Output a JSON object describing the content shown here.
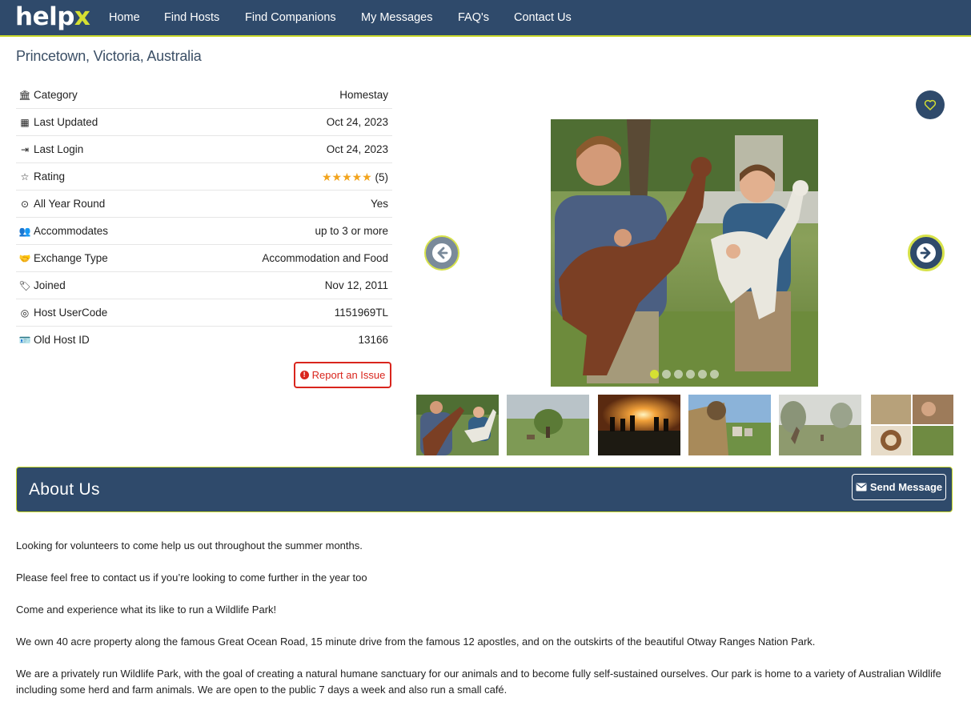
{
  "nav": {
    "logo_main": "help",
    "logo_accent": "x",
    "links": [
      "Home",
      "Find Hosts",
      "Find Companions",
      "My Messages",
      "FAQ's",
      "Contact Us"
    ]
  },
  "location": "Princetown, Victoria, Australia",
  "info": [
    {
      "label": "Category",
      "value": "Homestay",
      "icon": "bank-icon"
    },
    {
      "label": "Last Updated",
      "value": "Oct 24, 2023",
      "icon": "calendar-icon"
    },
    {
      "label": "Last Login",
      "value": "Oct 24, 2023",
      "icon": "sign-in-icon"
    },
    {
      "label": "Rating",
      "value": "(5)",
      "icon": "star-outline-icon",
      "stars": "★★★★★"
    },
    {
      "label": "All Year Round",
      "value": "Yes",
      "icon": "clock-icon"
    },
    {
      "label": "Accommodates",
      "value": "up to 3 or more",
      "icon": "users-icon"
    },
    {
      "label": "Exchange Type",
      "value": "Accommodation and Food",
      "icon": "handshake-icon"
    },
    {
      "label": "Joined",
      "value": "Nov 12, 2011",
      "icon": "tag-icon"
    },
    {
      "label": "Host UserCode",
      "value": "1151969TL",
      "icon": "bullseye-icon"
    },
    {
      "label": "Old Host ID",
      "value": "13166",
      "icon": "id-card-icon"
    }
  ],
  "report_button": "Report an Issue",
  "gallery": {
    "slide_count": 6,
    "active_slide": 1
  },
  "about": {
    "title": "About Us",
    "send_button": "Send Message",
    "paragraphs": [
      "Looking for volunteers to come help us out throughout the summer months.",
      "Please feel free to contact us if you’re looking to come further in the year too",
      "Come and experience what its like to run a Wildlife Park!",
      "We own 40 acre property along the famous Great Ocean Road, 15 minute drive from the famous 12 apostles, and on the outskirts of the beautiful Otway Ranges Nation Park.",
      "We are a privately run Wildlife Park, with the goal of creating a natural humane sanctuary for our animals and to become fully self-sustained ourselves. Our park is home to a variety of Australian Wildlife including some herd and farm animals. We are open to the public 7 days a week and also run a small café."
    ]
  },
  "colors": {
    "nav_bg": "#2f4a6b",
    "accent": "#d6e032",
    "star": "#f2a41e",
    "danger": "#d9251d"
  }
}
